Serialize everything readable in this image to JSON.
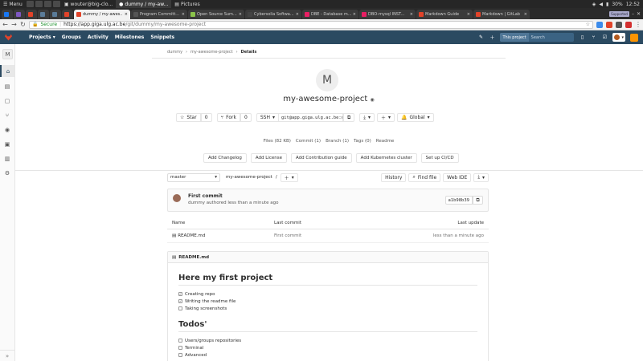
{
  "taskbar": {
    "menu_label": "Menu",
    "windows": [
      {
        "label": "wouter@big-clo...",
        "active": false
      },
      {
        "label": "dummy / my-aw...",
        "active": true
      },
      {
        "label": "Pictures",
        "active": false
      }
    ],
    "battery": "30%",
    "time": "12:52"
  },
  "browser": {
    "tabs": [
      {
        "label": "",
        "color": "#1877f2",
        "active": false,
        "small": true
      },
      {
        "label": "",
        "color": "#7e57c2",
        "active": false,
        "small": true
      },
      {
        "label": "",
        "color": "#e24329",
        "active": false,
        "small": true
      },
      {
        "label": "",
        "color": "#5b7c99",
        "active": false,
        "small": true
      },
      {
        "label": "",
        "color": "#5b7c99",
        "active": false,
        "small": true
      },
      {
        "label": "",
        "color": "#e24329",
        "active": false,
        "small": true
      },
      {
        "label": "dummy / my-awes...",
        "color": "#e24329",
        "active": true,
        "small": false
      },
      {
        "label": "Program Committ...",
        "color": "#555555",
        "active": false,
        "small": false
      },
      {
        "label": "Open Source Sum...",
        "color": "#8bc34a",
        "active": false,
        "small": false
      },
      {
        "label": "Cybersolia Softwa...",
        "color": "#444444",
        "active": false,
        "small": false
      },
      {
        "label": "DBE - Database m...",
        "color": "#e91e63",
        "active": false,
        "small": false
      },
      {
        "label": "DBO-mysql INST...",
        "color": "#e91e63",
        "active": false,
        "small": false
      },
      {
        "label": "Markdown Guide",
        "color": "#e24329",
        "active": false,
        "small": false
      },
      {
        "label": "Markdown | GitLab",
        "color": "#e24329",
        "active": false,
        "small": false
      }
    ],
    "profile_badge": "Supported",
    "address": {
      "secure_label": "Secure",
      "url_scheme_host": "https://app.giga.ulg.ac.be",
      "url_path": "/git/dummy/my-awesome-project"
    }
  },
  "gitlab_header": {
    "nav": [
      "Projects ▾",
      "Groups",
      "Activity",
      "Milestones",
      "Snippets"
    ],
    "search_scope": "This project",
    "search_placeholder": "Search"
  },
  "sidebar": {
    "project_initial": "M",
    "collapse_glyph": "»"
  },
  "breadcrumb": [
    "dummy",
    "my-awesome-project",
    "Details"
  ],
  "project": {
    "initial": "M",
    "name": "my-awesome-project",
    "star_label": "Star",
    "star_count": "0",
    "fork_label": "Fork",
    "fork_count": "0",
    "clone_protocol": "SSH",
    "clone_url": "git@app.giga.ulg.ac.be:dummy/m",
    "notification_label": "Global"
  },
  "stats": [
    "Files (82 KB)",
    "Commit (1)",
    "Branch (1)",
    "Tags (0)",
    "Readme"
  ],
  "suggestions": [
    "Add Changelog",
    "Add License",
    "Add Contribution guide",
    "Add Kubernetes cluster",
    "Set up CI/CD"
  ],
  "tree": {
    "branch": "master",
    "path": "my-awesome-project",
    "path_separator": "/",
    "history_label": "History",
    "find_file_label": "Find file",
    "web_ide_label": "Web IDE"
  },
  "last_commit": {
    "title": "First commit",
    "meta": "dummy authored less than a minute ago",
    "sha": "a1b98b39"
  },
  "file_table": {
    "headers": {
      "name": "Name",
      "last_commit": "Last commit",
      "last_update": "Last update"
    },
    "rows": [
      {
        "name": "README.md",
        "commit": "First commit",
        "update": "less than a minute ago"
      }
    ]
  },
  "readme": {
    "header": "README.md",
    "h1": "Here my first project",
    "tasks1": [
      {
        "label": "Creating repo",
        "checked": true
      },
      {
        "label": "Writing the readme file",
        "checked": true
      },
      {
        "label": "Taking screenshots",
        "checked": false
      }
    ],
    "h2": "Todos'",
    "tasks2": [
      {
        "label": "Users/groups repositories",
        "checked": false
      },
      {
        "label": "Terminal",
        "checked": false
      },
      {
        "label": "Advanced",
        "checked": false
      }
    ]
  }
}
